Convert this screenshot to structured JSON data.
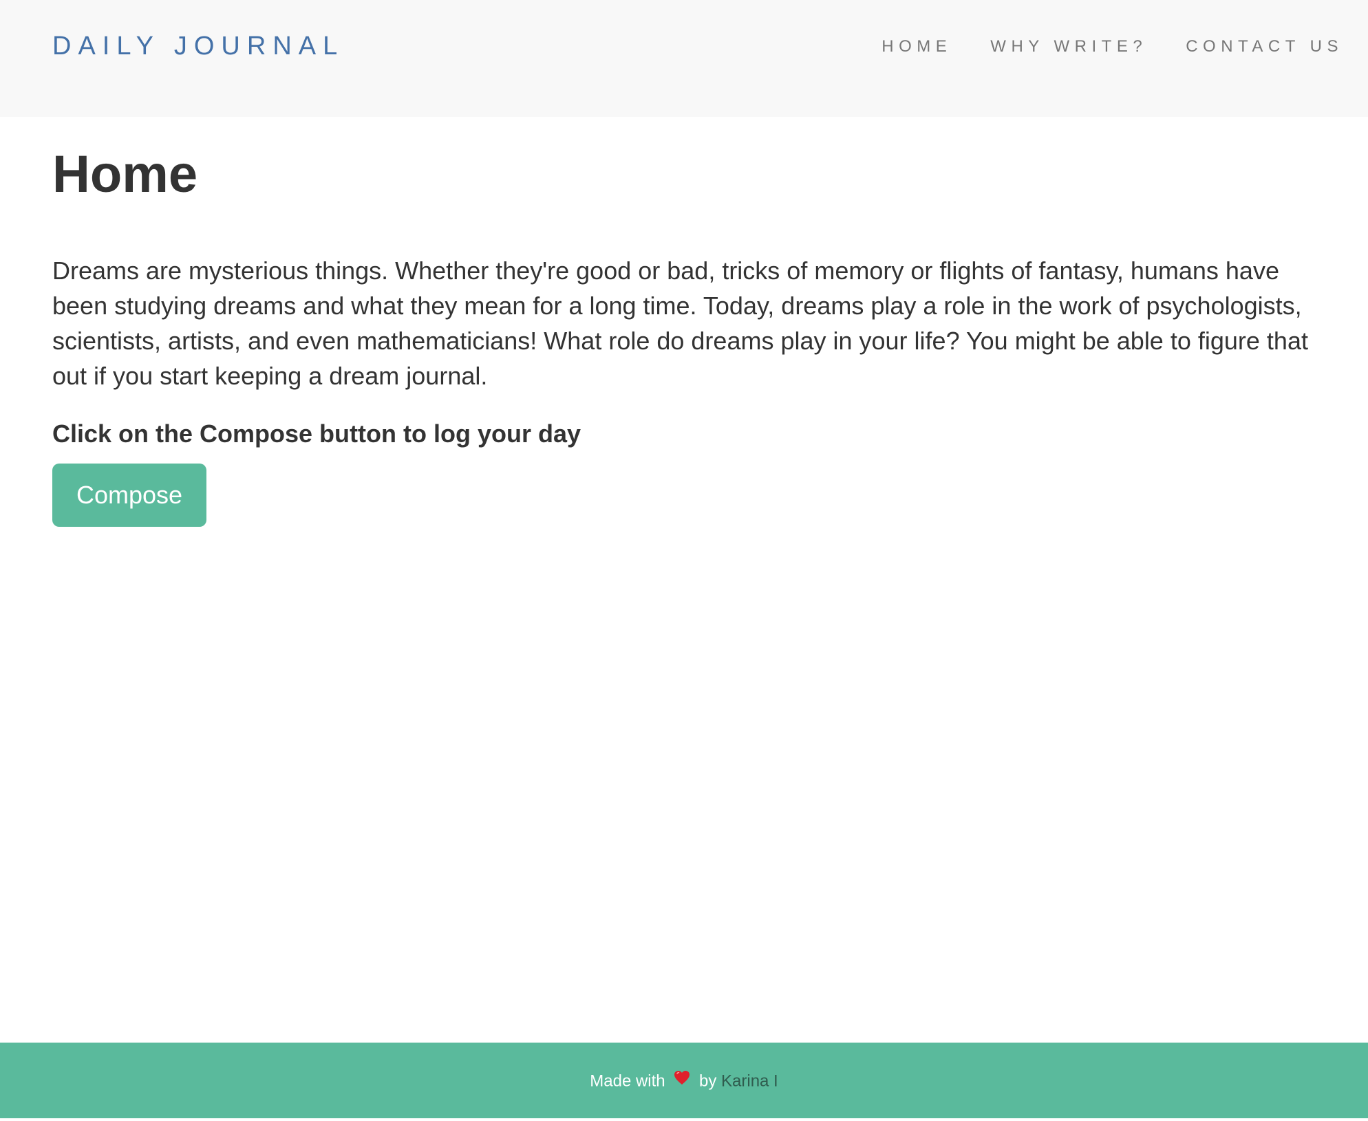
{
  "navbar": {
    "brand": "DAILY JOURNAL",
    "links": [
      {
        "label": "HOME"
      },
      {
        "label": "WHY WRITE?"
      },
      {
        "label": "CONTACT US"
      }
    ]
  },
  "main": {
    "title": "Home",
    "intro": "Dreams are mysterious things. Whether they're good or bad, tricks of memory or flights of fantasy, humans have been studying dreams and what they mean for a long time. Today, dreams play a role in the work of psychologists, scientists, artists, and even mathematicians! What role do dreams play in your life? You might be able to figure that out if you start keeping a dream journal.",
    "cta_text": "Click on the Compose button to log your day",
    "compose_label": "Compose"
  },
  "footer": {
    "made_with": "Made with",
    "heart_icon": "heart-icon",
    "by": "by",
    "author": "Karina I"
  },
  "colors": {
    "brand": "#4471a8",
    "accent": "#5aba9c",
    "nav_bg": "#f8f8f8",
    "text": "#333333",
    "author_link": "#2f5c4e",
    "heart": "#e0202c"
  }
}
